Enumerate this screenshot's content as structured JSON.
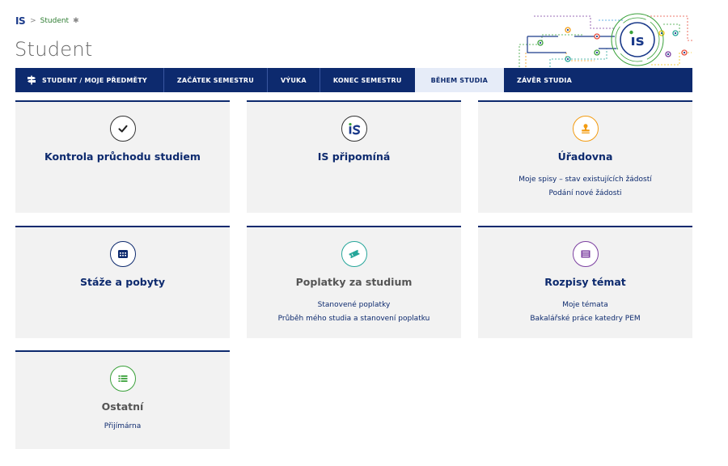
{
  "breadcrumb": {
    "logo": "IS",
    "separator": ">",
    "current": "Student",
    "pin": "✱"
  },
  "page": {
    "title": "Student"
  },
  "nav": {
    "items": [
      {
        "label": "STUDENT / MOJE PŘEDMĚTY"
      },
      {
        "label": "ZAČÁTEK SEMESTRU"
      },
      {
        "label": "VÝUKA"
      },
      {
        "label": "KONEC SEMESTRU"
      },
      {
        "label": "BĚHEM STUDIA",
        "active": true
      },
      {
        "label": "ZÁVĚR STUDIA"
      }
    ]
  },
  "colors": {
    "nav_bg": "#0d2a6e",
    "nav_active_bg": "#e6ecf8",
    "card_bg": "#f2f2f2",
    "accent_green": "#3aa13a",
    "accent_orange": "#f39c12",
    "accent_teal": "#26a69a",
    "accent_purple": "#7b3fa0"
  },
  "cards": [
    {
      "title": "Kontrola průchodu studiem",
      "icon": "check-icon",
      "links": []
    },
    {
      "title": "IS připomíná",
      "icon": "is-logo-icon",
      "links": []
    },
    {
      "title": "Úřadovna",
      "icon": "stamp-icon",
      "links": [
        "Moje spisy – stav existujících žádostí",
        "Podání nové žádosti"
      ]
    },
    {
      "title": "Stáže a pobyty",
      "icon": "calendar-icon",
      "links": []
    },
    {
      "title": "Poplatky za studium",
      "icon": "ticket-icon",
      "links": [
        "Stanovené poplatky",
        "Průběh mého studia a stanovení poplatku"
      ]
    },
    {
      "title": "Rozpisy témat",
      "icon": "list-box-icon",
      "links": [
        "Moje témata",
        "Bakalářské práce katedry PEM"
      ]
    },
    {
      "title": "Ostatní",
      "icon": "list-icon",
      "links": [
        "Přijímárna"
      ]
    }
  ]
}
